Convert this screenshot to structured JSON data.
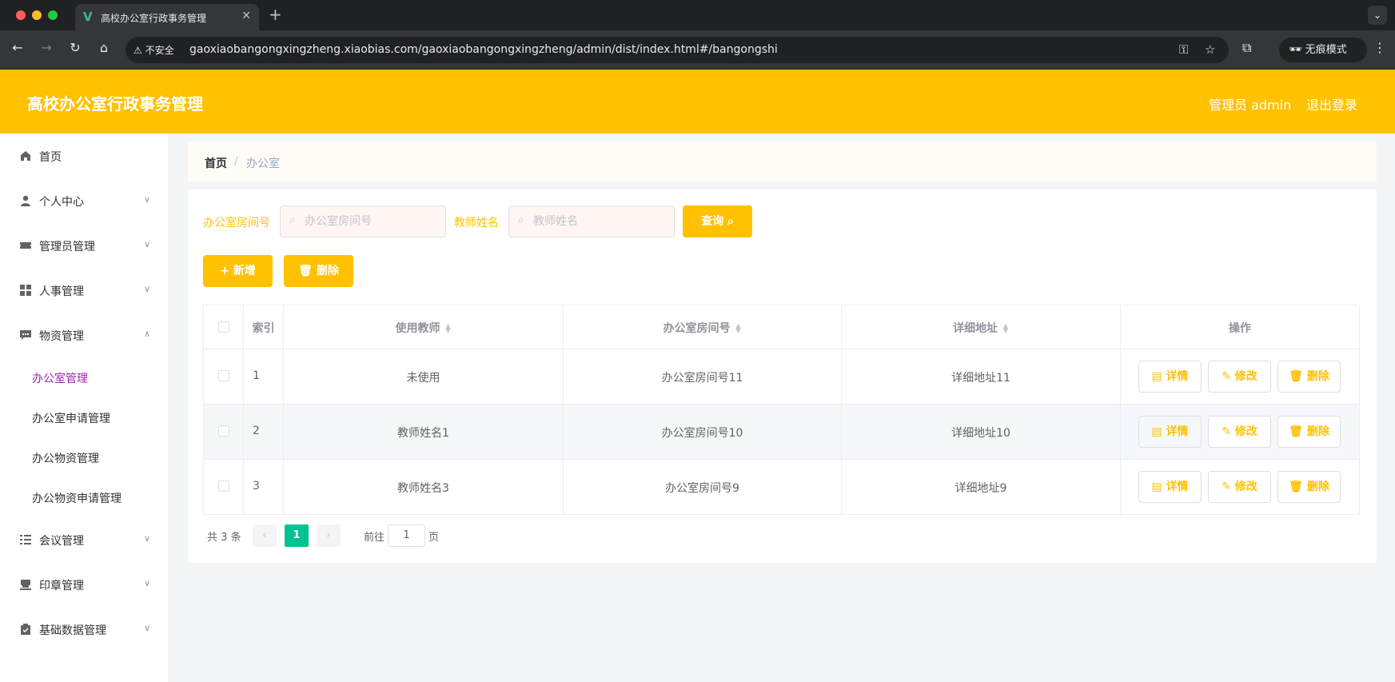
{
  "browser": {
    "tab_title": "高校办公室行政事务管理",
    "tab_favicon": "V",
    "security_label": "不安全",
    "url": "gaoxiaobangongxingzheng.xiaobias.com/gaoxiaobangongxingzheng/admin/dist/index.html#/bangongshi",
    "incognito_label": "无痕模式"
  },
  "header": {
    "title": "高校办公室行政事务管理",
    "user_label": "管理员 admin",
    "logout_label": "退出登录",
    "brand_color": "#ffc100"
  },
  "sidebar": {
    "items": [
      {
        "label": "首页",
        "icon": "home-icon"
      },
      {
        "label": "个人中心",
        "icon": "user-icon"
      },
      {
        "label": "管理员管理",
        "icon": "ticket-icon"
      },
      {
        "label": "人事管理",
        "icon": "grid-icon"
      },
      {
        "label": "物资管理",
        "icon": "chat-icon"
      },
      {
        "label": "会议管理",
        "icon": "list-icon"
      },
      {
        "label": "印章管理",
        "icon": "stamp-icon"
      },
      {
        "label": "基础数据管理",
        "icon": "clipboard-icon"
      }
    ],
    "submenu": [
      {
        "label": "办公室管理",
        "active": true
      },
      {
        "label": "办公室申请管理",
        "active": false
      },
      {
        "label": "办公物资管理",
        "active": false
      },
      {
        "label": "办公物资申请管理",
        "active": false
      }
    ]
  },
  "breadcrumb": {
    "home": "首页",
    "separator": "/",
    "current": "办公室"
  },
  "search": {
    "room_label": "办公室房间号",
    "room_placeholder": "办公室房间号",
    "teacher_label": "教师姓名",
    "teacher_placeholder": "教师姓名",
    "query_button": "查询"
  },
  "actions": {
    "add_button": "新增",
    "delete_button": "删除"
  },
  "table": {
    "headers": {
      "index": "索引",
      "teacher": "使用教师",
      "room": "办公室房间号",
      "address": "详细地址",
      "operation": "操作"
    },
    "rows": [
      {
        "index": "1",
        "teacher": "未使用",
        "room": "办公室房间号11",
        "address": "详细地址11"
      },
      {
        "index": "2",
        "teacher": "教师姓名1",
        "room": "办公室房间号10",
        "address": "详细地址10"
      },
      {
        "index": "3",
        "teacher": "教师姓名3",
        "room": "办公室房间号9",
        "address": "详细地址9"
      }
    ],
    "row_buttons": {
      "detail": "详情",
      "edit": "修改",
      "delete": "删除"
    }
  },
  "pagination": {
    "total": "共 3 条",
    "current_page": "1",
    "goto_label": "前往",
    "goto_value": "1",
    "page_suffix": "页"
  }
}
